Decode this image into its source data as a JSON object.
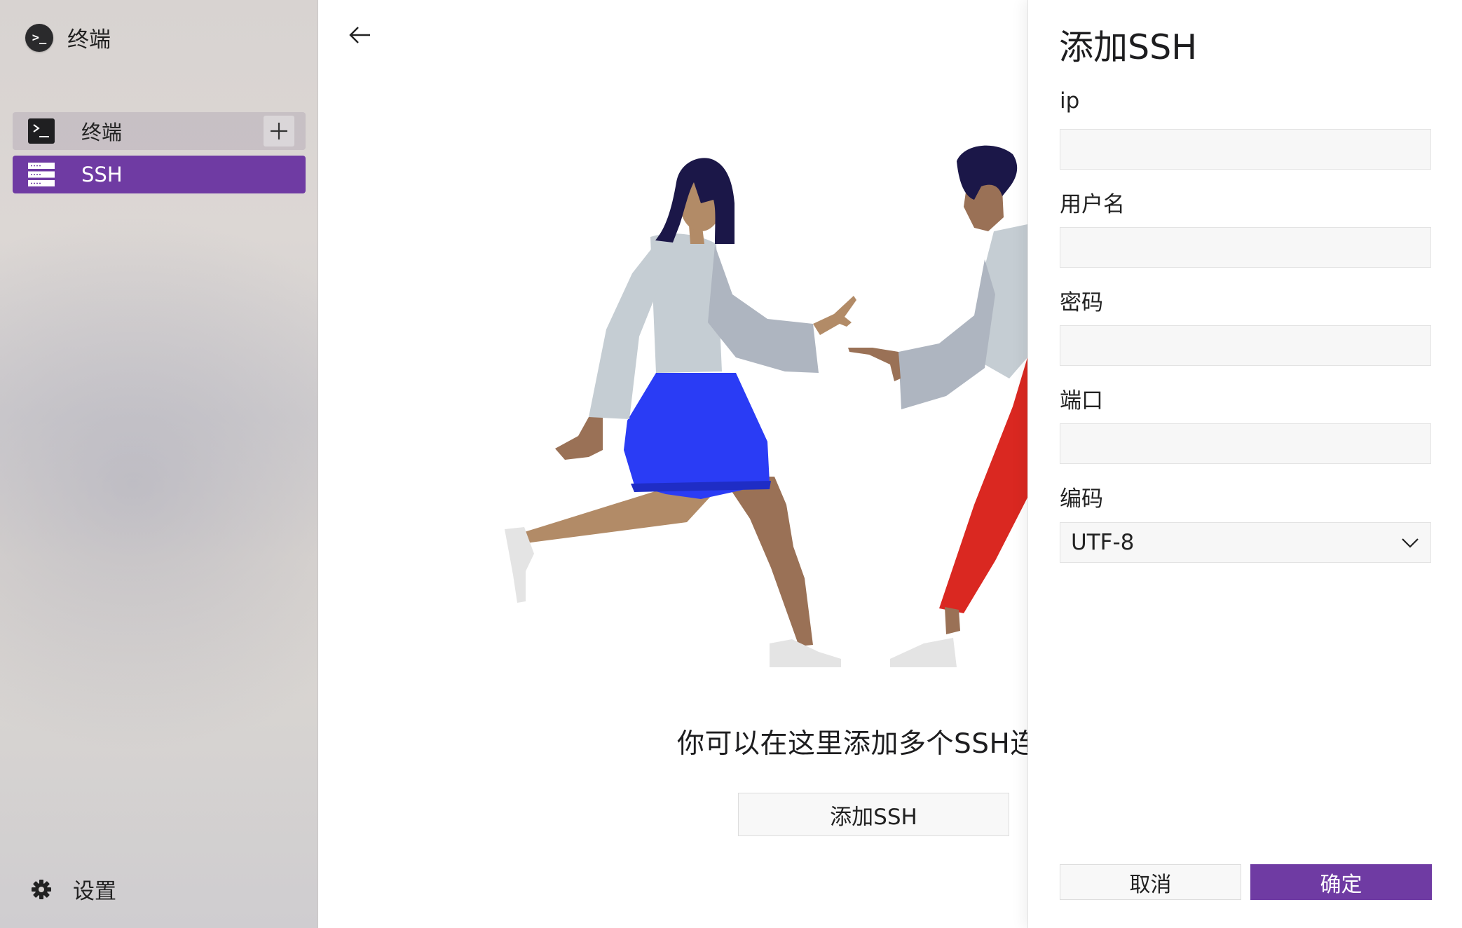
{
  "app": {
    "title": "终端",
    "icon": "terminal-prompt-icon"
  },
  "sidebar": {
    "items": [
      {
        "label": "终端",
        "icon": "terminal-icon",
        "selected": false,
        "add_icon": "plus-icon"
      },
      {
        "label": "SSH",
        "icon": "server-icon",
        "selected": true
      }
    ],
    "settings": {
      "label": "设置",
      "icon": "gear-icon"
    }
  },
  "main": {
    "back_icon": "arrow-left-icon",
    "empty_message": "你可以在这里添加多个SSH连接",
    "add_button_label": "添加SSH"
  },
  "drawer": {
    "title": "添加SSH",
    "fields": [
      {
        "label": "ip",
        "value": ""
      },
      {
        "label": "用户名",
        "value": ""
      },
      {
        "label": "密码",
        "value": ""
      },
      {
        "label": "端口",
        "value": ""
      }
    ],
    "encoding": {
      "label": "编码",
      "value": "UTF-8",
      "icon": "chevron-down-icon"
    },
    "cancel_label": "取消",
    "confirm_label": "确定"
  },
  "colors": {
    "accent": "#6f3ba3",
    "skirt": "#2a3cf5",
    "pants": "#da2821",
    "hair": "#1b1748",
    "skin_light": "#b28b67",
    "skin_dark": "#9a7156",
    "shirt": "#c5cdd3",
    "shoes": "#e4e4e4"
  }
}
